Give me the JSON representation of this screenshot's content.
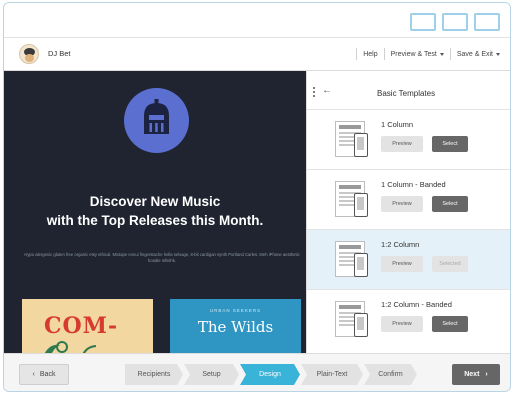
{
  "header": {
    "user_name": "DJ Bet",
    "menu": {
      "help": "Help",
      "preview_test": "Preview & Test",
      "save_exit": "Save & Exit"
    }
  },
  "email_preview": {
    "headline_line1": "Discover New Music",
    "headline_line2": "with the Top Releases this Month.",
    "blurb": "Hypo alergenic gluten free organic etsy ethical. Mixtape ennui fingerstache hella selvage, 8-bit cardigan synth Portland Carles. Meh iPhone aesthetic hoodie mlkshk.",
    "card_left_text": "COM-",
    "card_right_subtitle": "URBAN SEEKERS",
    "card_right_title": "The Wilds"
  },
  "templates_panel": {
    "title": "Basic Templates",
    "templates": [
      {
        "name": "1 Column",
        "preview_label": "Preview",
        "select_label": "Select",
        "selected": false
      },
      {
        "name": "1 Column - Banded",
        "preview_label": "Preview",
        "select_label": "Select",
        "selected": false
      },
      {
        "name": "1:2 Column",
        "preview_label": "Preview",
        "select_label": "Selected",
        "selected": true
      },
      {
        "name": "1:2 Column - Banded",
        "preview_label": "Preview",
        "select_label": "Select",
        "selected": false
      }
    ]
  },
  "footer": {
    "back_label": "Back",
    "next_label": "Next",
    "steps": [
      "Recipients",
      "Setup",
      "Design",
      "Plain-Text",
      "Confirm"
    ],
    "active_step": "Design"
  },
  "colors": {
    "accent": "#39b3d7",
    "preview_bg": "#1f2430",
    "logo_circle": "#5b6fd0",
    "selected_row": "#e4f1f8"
  }
}
